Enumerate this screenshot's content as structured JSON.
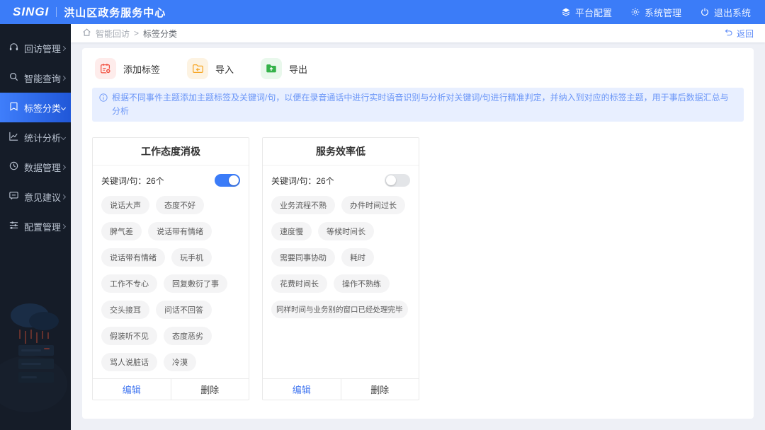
{
  "header": {
    "logo": "SINGI",
    "title": "洪山区政务服务中心",
    "nav": [
      {
        "label": "平台配置",
        "icon": "platform-icon"
      },
      {
        "label": "系统管理",
        "icon": "gear-icon"
      },
      {
        "label": "退出系统",
        "icon": "power-icon"
      }
    ]
  },
  "sidebar": {
    "active_item": "标签分类",
    "items": [
      {
        "label": "回访管理",
        "icon": "headset-icon",
        "chevron": "right"
      },
      {
        "label": "智能查询",
        "icon": "search-icon",
        "chevron": "right"
      },
      {
        "label": "标签分类",
        "icon": "bookmark-icon",
        "chevron": "down"
      },
      {
        "label": "统计分析",
        "icon": "chart-icon",
        "chevron": "down"
      },
      {
        "label": "数据管理",
        "icon": "clock-icon",
        "chevron": "right"
      },
      {
        "label": "意见建议",
        "icon": "comment-icon",
        "chevron": "right"
      },
      {
        "label": "配置管理",
        "icon": "sliders-icon",
        "chevron": "right"
      }
    ]
  },
  "breadcrumb": {
    "section": "智能回访",
    "separator": ">",
    "current": "标签分类"
  },
  "back_button": {
    "label": "返回"
  },
  "toolbar": {
    "buttons": [
      {
        "label": "添加标签",
        "icon": "add-tag-icon"
      },
      {
        "label": "导入",
        "icon": "import-icon"
      },
      {
        "label": "导出",
        "icon": "export-icon"
      }
    ]
  },
  "banner": {
    "text": "根据不同事件主题添加主题标签及关键词/句，以便在录音通话中进行实时语音识别与分析对关键词/句进行精准判定，并纳入到对应的标签主题，用于事后数据汇总与分析"
  },
  "cards": [
    {
      "title": "工作态度消极",
      "keywords_label": "关键词/句：26个",
      "toggle_on": true,
      "tags": [
        "说话大声",
        "态度不好",
        "脾气差",
        "说话带有情绪",
        "说话带有情绪",
        "玩手机",
        "工作不专心",
        "回复敷衍了事",
        "交头接耳",
        "问话不回答",
        "假装听不见",
        "态度恶劣",
        "骂人说脏话",
        "冷漠"
      ],
      "edit_label": "编辑",
      "delete_label": "删除"
    },
    {
      "title": "服务效率低",
      "keywords_label": "关键词/句：26个",
      "toggle_on": false,
      "tags": [
        "业务流程不熟",
        "办件时间过长",
        "速度慢",
        "等候时间长",
        "需要同事协助",
        "耗时",
        "花费时间长",
        "操作不熟练",
        "同样时间与业务别的窗口已经处理完毕"
      ],
      "edit_label": "编辑",
      "delete_label": "删除"
    }
  ],
  "colors": {
    "header_blue": "#3b7cf8",
    "sidebar_bg": "#151c28",
    "active_gradient_start": "#3f7efb",
    "active_gradient_end": "#2057d8",
    "banner_bg": "#e8efff",
    "banner_text": "#6b96f7",
    "add_icon": "#f2503f",
    "import_icon": "#f7a727",
    "export_icon": "#35b24a",
    "edit_link": "#4a7cf0",
    "toggle_on": "#3b7cf8"
  }
}
